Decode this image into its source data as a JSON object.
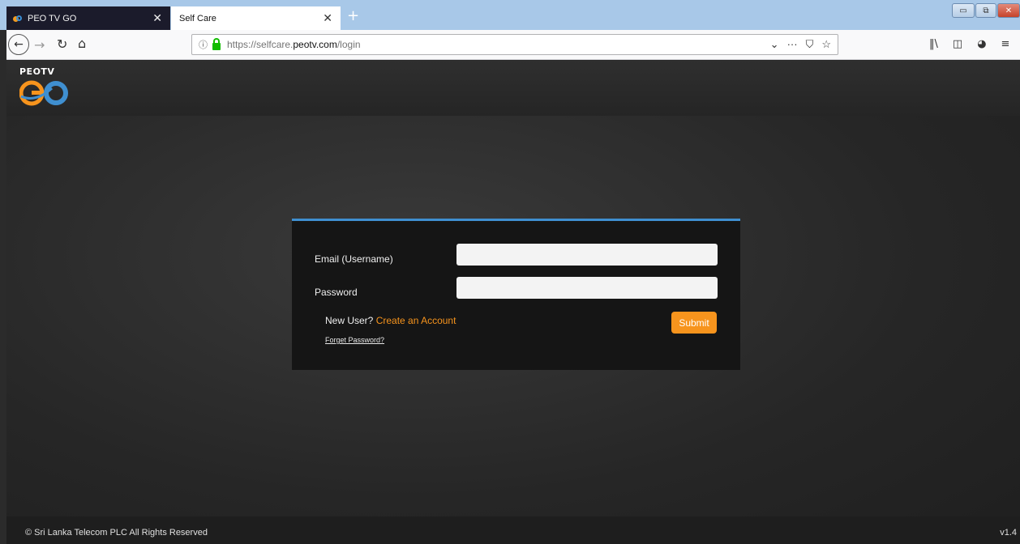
{
  "browser": {
    "tabs": [
      {
        "label": "PEO TV GO",
        "close": "✕"
      },
      {
        "label": "Self Care",
        "close": "✕"
      }
    ],
    "new_tab": "+",
    "window_controls": {
      "minimize": "▭",
      "maximize": "⧉",
      "close": "✕"
    },
    "nav": {
      "back": "←",
      "forward": "→",
      "reload": "↻",
      "home": "⌂"
    },
    "url": {
      "prefix": "https://selfcare.",
      "domain": "peotv.com",
      "path": "/login",
      "info_icon": "ⓘ"
    },
    "url_actions": [
      "⌄",
      "···",
      "⛉",
      "☆"
    ],
    "toolbar_icons": [
      "library-icon",
      "sidebar-icon",
      "extension-icon",
      "menu-icon"
    ],
    "toolbar_glyphs": [
      "‖\\",
      "◫",
      "◕",
      "≡"
    ]
  },
  "site": {
    "logo_text": "PEOTV",
    "accent_color": "#f7941d",
    "card_border_color": "#3f8fd0"
  },
  "login": {
    "email_label": "Email (Username)",
    "email_value": "",
    "password_label": "Password",
    "password_value": "",
    "new_user_text": "New User?",
    "create_account": "Create an Account",
    "forget_password": "Forget Password?",
    "submit": "Submit"
  },
  "footer": {
    "copyright": "© Sri Lanka Telecom PLC All Rights Reserved",
    "version": "v1.4"
  }
}
